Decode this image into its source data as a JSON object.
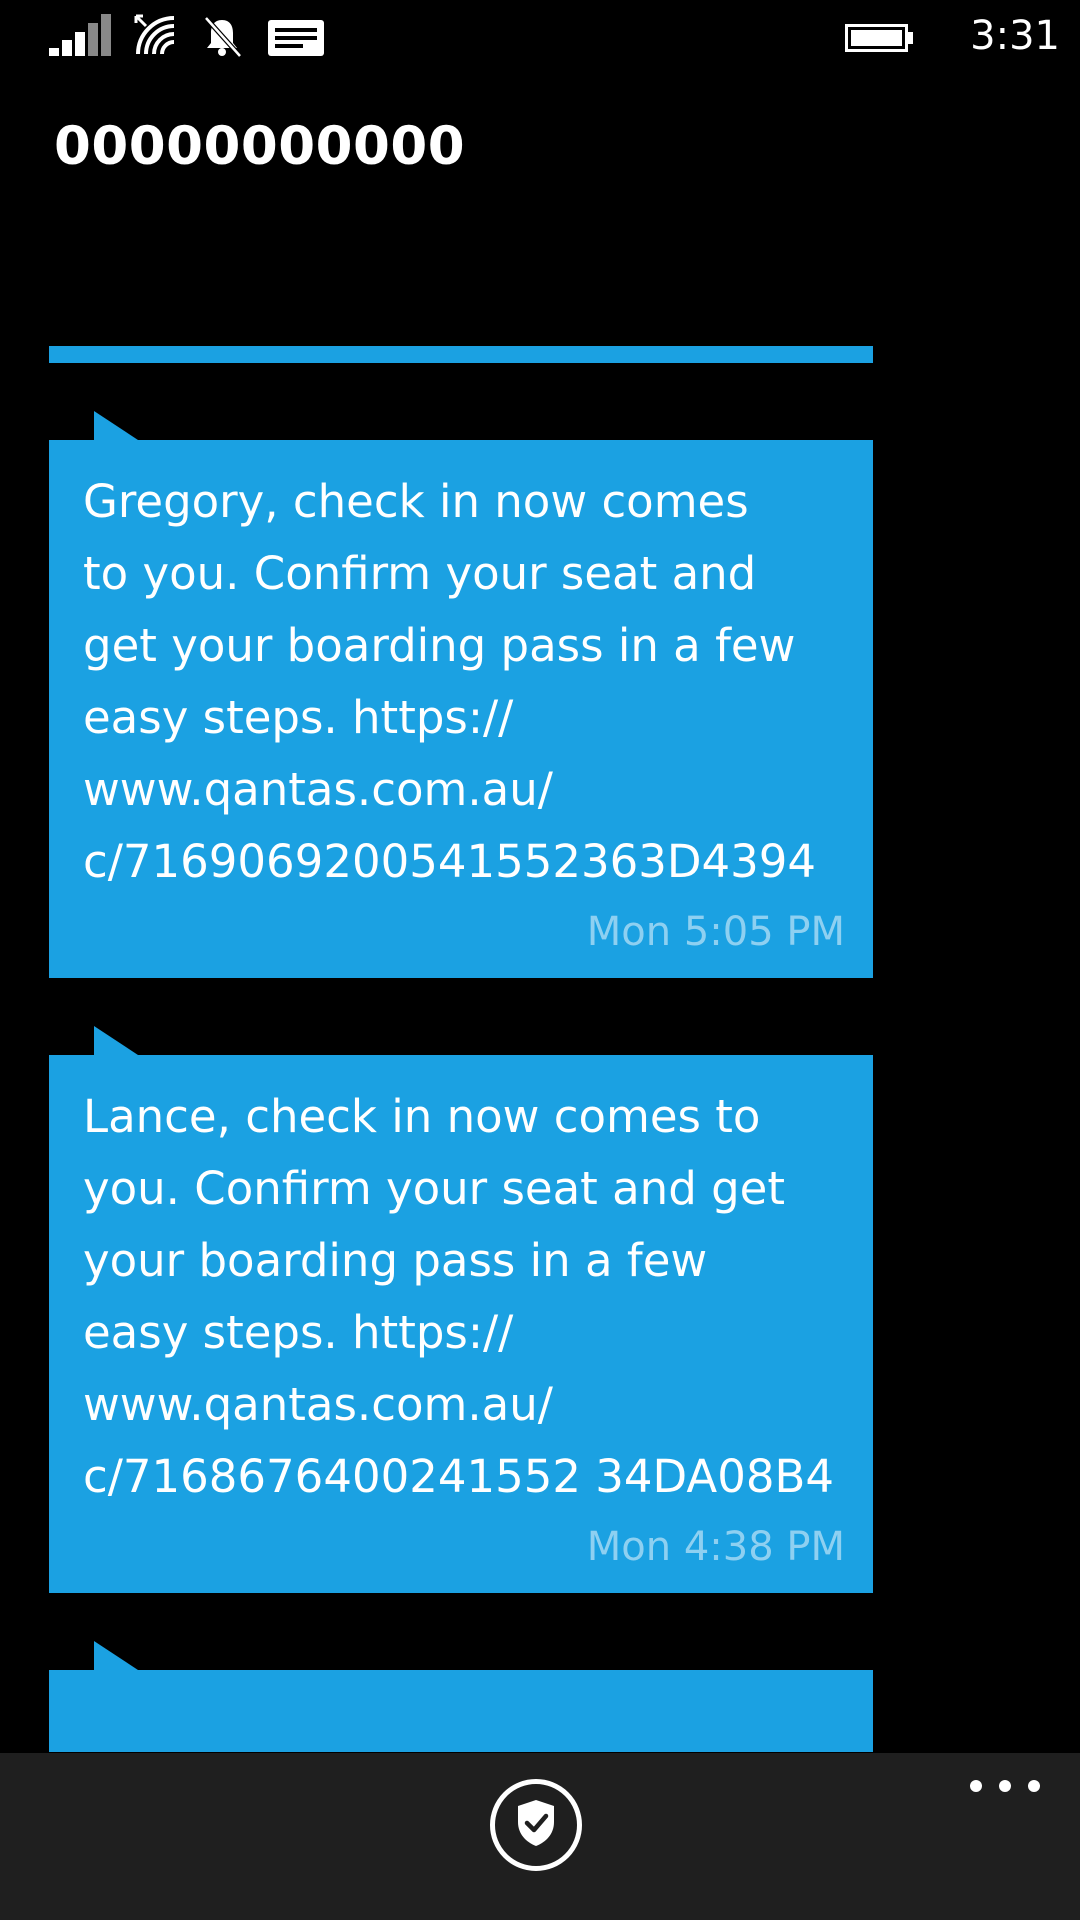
{
  "status_bar": {
    "time": "3:31",
    "icons": [
      "signal-icon",
      "wifi-icon",
      "bell-muted-icon",
      "message-icon",
      "battery-icon"
    ]
  },
  "thread": {
    "title": "00000000000"
  },
  "messages": [
    {
      "text": "Gregory, check in now comes\nto you. Confirm your seat and\nget your boarding pass in a few\neasy steps. https://\nwww.qantas.com.au/\nc/7169069200541552363D4394",
      "time": "Mon 5:05 PM"
    },
    {
      "text": "Lance, check in now comes to\nyou. Confirm your seat and get\nyour boarding pass in a few\neasy steps. https://\nwww.qantas.com.au/\nc/7168676400241552 34DA08B4",
      "time": "Mon 4:38 PM"
    }
  ],
  "app_bar": {
    "icons": [
      "shield-check-icon",
      "more-icon"
    ]
  },
  "colors": {
    "accent": "#1ba1e2",
    "background": "#000000",
    "app_bar": "#1f1f1f",
    "timestamp": "#8ed0f1"
  }
}
